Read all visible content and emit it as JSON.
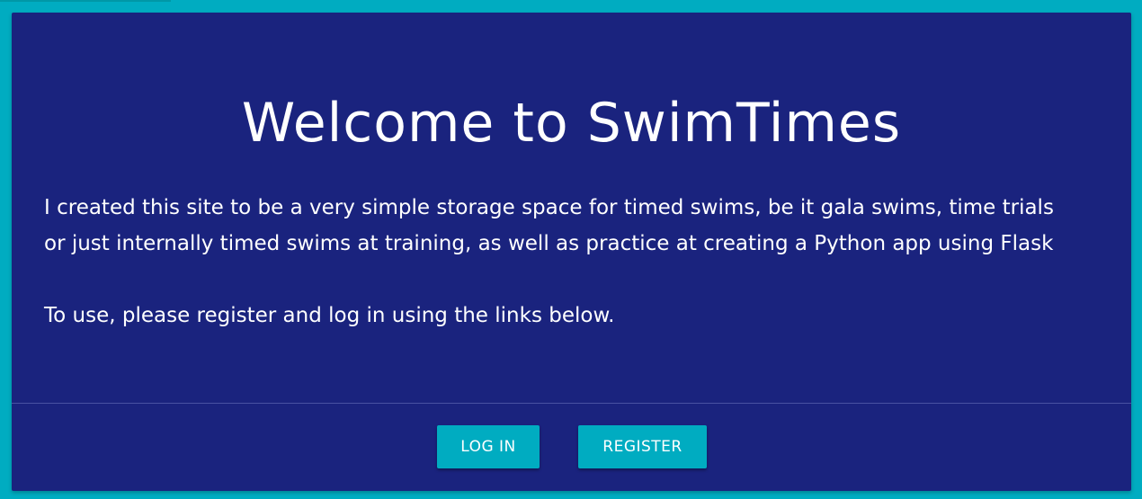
{
  "card": {
    "title": "Welcome to SwimTimes",
    "paragraphs": [
      "I created this site to be a very simple storage space for timed swims, be it gala swims, time trials or just internally timed swims at training, as well as practice at creating a Python app using Flask",
      "To use, please register and log in using the links below."
    ]
  },
  "actions": {
    "login_label": "Log In",
    "register_label": "Register"
  },
  "colors": {
    "background": "#00acc1",
    "card": "#1a237e",
    "button": "#00acc1",
    "text": "#ffffff"
  }
}
